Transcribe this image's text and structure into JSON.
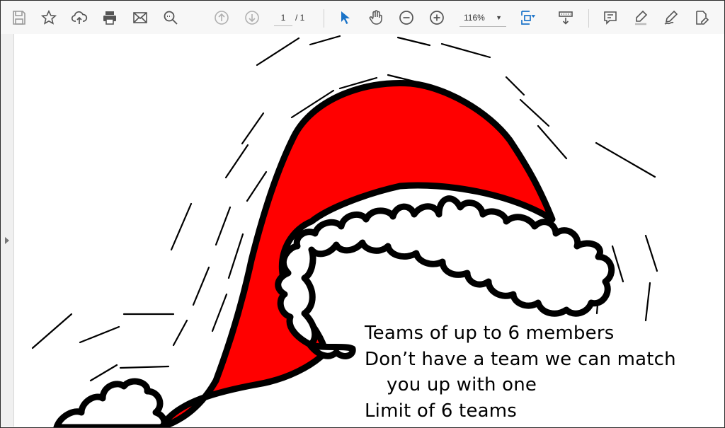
{
  "toolbar": {
    "icons": [
      "save-icon",
      "star-icon",
      "upload-icon",
      "print-icon",
      "email-icon",
      "search-zoom-icon",
      "prev-page-icon",
      "next-page-icon",
      "select-cursor-icon",
      "hand-icon",
      "zoom-out-icon",
      "zoom-in-icon",
      "fit-page-icon",
      "scroll-mode-icon",
      "comment-icon",
      "highlight-icon",
      "sign-icon",
      "edit-icon"
    ],
    "page_current": "1",
    "page_total": "/ 1",
    "zoom_value": "116%",
    "zoom_arrow": "▼",
    "accent_color": "#1a73c8"
  },
  "document": {
    "lines": [
      "Teams of up to 6 members",
      "Don’t have a team we can match",
      "you up with one",
      "Limit of 6 teams"
    ],
    "colors": {
      "hat_red": "#ff0000",
      "outline": "#000000",
      "fur": "#ffffff"
    }
  }
}
